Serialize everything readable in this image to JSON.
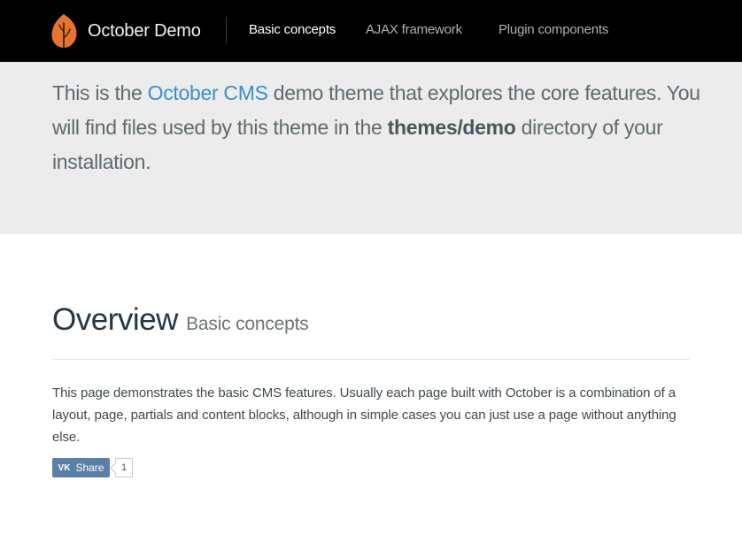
{
  "nav": {
    "brand": "October Demo",
    "links": [
      {
        "label": "Basic concepts",
        "active": true
      },
      {
        "label": "AJAX framework",
        "active": false
      },
      {
        "label": "Plugin components",
        "active": false
      }
    ]
  },
  "jumbotron": {
    "text_1": "This is the ",
    "link": "October CMS",
    "text_2": " demo theme that explores the core features. You will find files used by this theme in the ",
    "path": "themes/demo",
    "text_3": " directory of your installation."
  },
  "overview": {
    "title": "Overview",
    "subtitle": "Basic concepts",
    "text": "This page demonstrates the basic CMS features. Usually each page built with October is a combination of a layout, page, partials and content blocks, although in simple cases you can just use a page without anything else."
  },
  "share": {
    "icon": "vk-icon",
    "label": "Share",
    "count": "1"
  },
  "colors": {
    "navbar": "#000000",
    "jumbotron": "#ececec",
    "link": "#3d8ec9",
    "logo": "#e8732f",
    "share": "#5b7fa6"
  }
}
